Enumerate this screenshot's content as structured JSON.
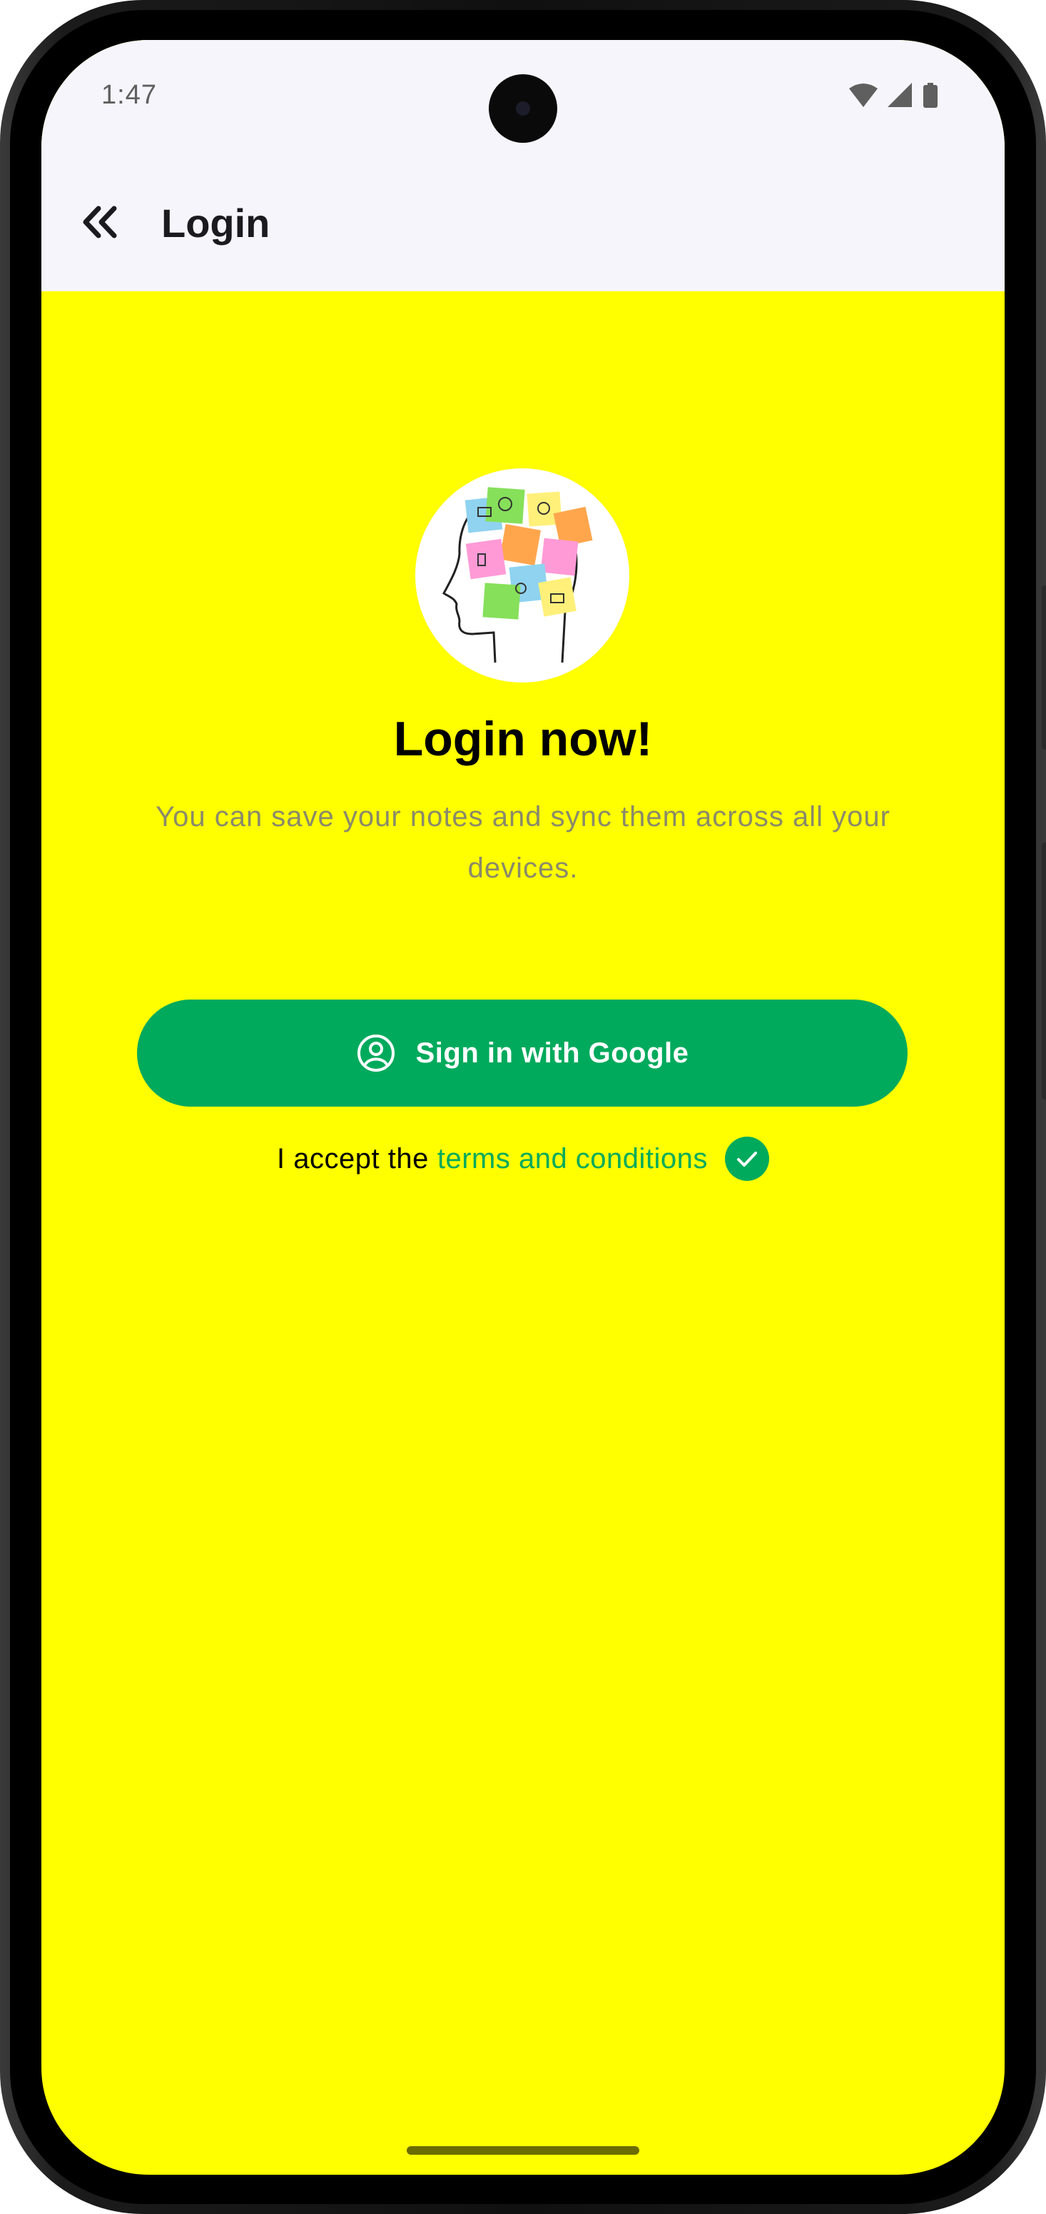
{
  "status_bar": {
    "time": "1:47",
    "icons": [
      "wifi-icon",
      "cellular-signal-icon",
      "battery-icon"
    ]
  },
  "app_bar": {
    "back_icon": "double-chevron-left-icon",
    "title": "Login"
  },
  "login": {
    "logo_icon": "head-sticky-notes-logo",
    "heading": "Login now!",
    "subtitle": "You can save your notes and sync them across all your devices.",
    "google_button": {
      "icon": "account-circle-icon",
      "label": "Sign in with Google"
    },
    "terms": {
      "prefix": "I accept the",
      "link": "terms and conditions",
      "accepted": true
    }
  },
  "colors": {
    "background": "#ffff00",
    "app_bar_background": "#f7f5fc",
    "accent_green": "#00aa5c",
    "subtitle_text": "#8a8a6a",
    "home_indicator": "#6b6b00"
  }
}
